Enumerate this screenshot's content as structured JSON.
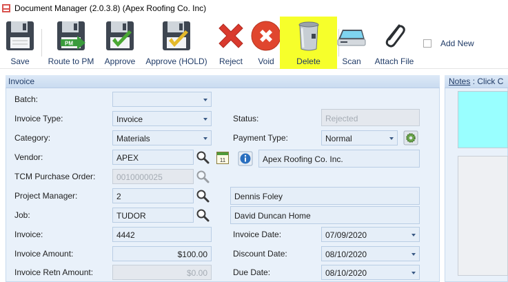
{
  "window": {
    "title": "Document Manager (2.0.3.8) (Apex Roofing Co. Inc)"
  },
  "toolbar": {
    "save": "Save",
    "route_to_pm": "Route to PM",
    "pm_badge": "PM",
    "approve": "Approve",
    "approve_hold": "Approve (HOLD)",
    "reject": "Reject",
    "void": "Void",
    "delete": "Delete",
    "scan": "Scan",
    "attach_file": "Attach File",
    "add_new": "Add New",
    "highlight_color": "#f6ff2b"
  },
  "invoice": {
    "header": "Invoice",
    "labels": {
      "batch": "Batch:",
      "invoice_type": "Invoice Type:",
      "category": "Category:",
      "vendor": "Vendor:",
      "tcm_po": "TCM Purchase Order:",
      "project_manager": "Project Manager:",
      "job": "Job:",
      "invoice": "Invoice:",
      "invoice_amount": "Invoice Amount:",
      "invoice_retn_amount": "Invoice Retn Amount:",
      "status": "Status:",
      "payment_type": "Payment Type:",
      "invoice_date": "Invoice Date:",
      "discount_date": "Discount Date:",
      "due_date": "Due Date:"
    },
    "values": {
      "batch": "",
      "invoice_type": "Invoice",
      "category": "Materials",
      "vendor": "APEX",
      "vendor_name": "Apex Roofing Co. Inc.",
      "tcm_po": "0010000025",
      "project_manager": "2",
      "project_manager_name": "Dennis Foley",
      "job": "TUDOR",
      "job_name": "David Duncan Home",
      "invoice": "4442",
      "invoice_amount": "$100.00",
      "invoice_retn_amount": "$0.00",
      "status": "Rejected",
      "payment_type": "Normal",
      "invoice_date": "07/09/2020",
      "discount_date": "08/10/2020",
      "due_date": "08/10/2020"
    },
    "calendar_day": "11"
  },
  "notes": {
    "title_prefix": "Notes",
    "title_suffix": " : Click C",
    "area_color": "#99ffff"
  }
}
